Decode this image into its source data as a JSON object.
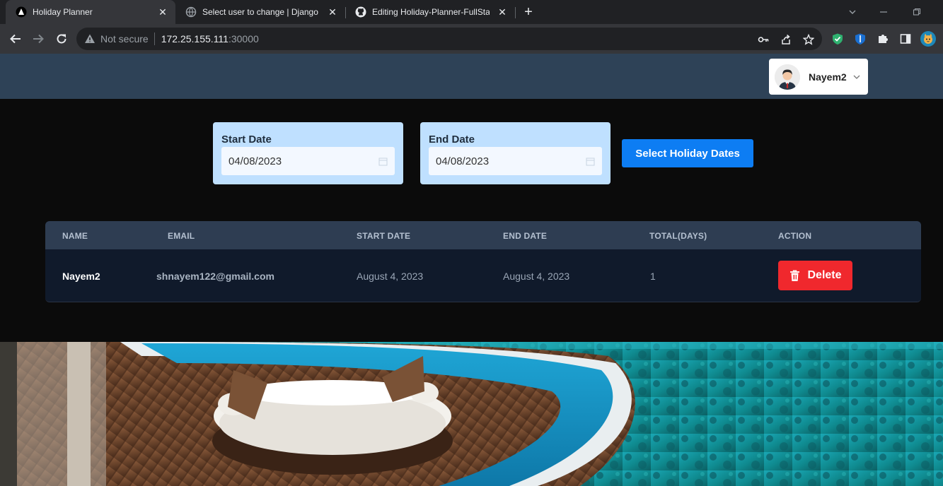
{
  "browser": {
    "tabs": [
      {
        "title": "Holiday Planner",
        "active": true,
        "icon": "holiday-planner-favicon"
      },
      {
        "title": "Select user to change | Django sit",
        "active": false,
        "icon": "globe-icon"
      },
      {
        "title": "Editing Holiday-Planner-FullStack",
        "active": false,
        "icon": "github-icon"
      }
    ],
    "new_tab": "+",
    "address": {
      "security_label": "Not secure",
      "host": "172.25.155.111",
      "port": ":30000"
    }
  },
  "header": {
    "user": {
      "name": "Nayem2"
    }
  },
  "date_form": {
    "start": {
      "label": "Start Date",
      "value": "04/08/2023"
    },
    "end": {
      "label": "End Date",
      "value": "04/08/2023"
    },
    "submit_label": "Select Holiday Dates"
  },
  "table": {
    "columns": [
      "NAME",
      "EMAIL",
      "START DATE",
      "END DATE",
      "TOTAL(DAYS)",
      "ACTION"
    ],
    "rows": [
      {
        "name": "Nayem2",
        "email": "shnayem122@gmail.com",
        "start_date": "August 4, 2023",
        "end_date": "August 4, 2023",
        "total_days": "1",
        "action_label": "Delete"
      }
    ]
  },
  "colors": {
    "appbar": "#2e4257",
    "date_card": "#bfe0ff",
    "primary_button": "#0d7df3",
    "delete_button": "#f0282d",
    "table_header": "#2e3d52",
    "table_row": "#101a2b"
  }
}
